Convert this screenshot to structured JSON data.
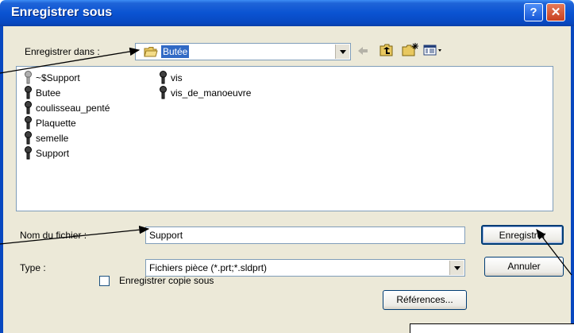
{
  "window": {
    "title": "Enregistrer sous",
    "help_glyph": "?",
    "close_glyph": "✕"
  },
  "save_in": {
    "label": "Enregistrer dans :",
    "folder": "Butée"
  },
  "toolbar": {
    "icons": [
      "back-arrow-icon",
      "up-folder-icon",
      "new-folder-icon",
      "view-menu-icon"
    ]
  },
  "files": {
    "column1": [
      "~$Support",
      "Butee",
      "coulisseau_penté",
      "Plaquette",
      "semelle",
      "Support"
    ],
    "column2": [
      "vis",
      "vis_de_manoeuvre"
    ]
  },
  "filename": {
    "label": "Nom du fichier :",
    "value": "Support"
  },
  "type": {
    "label": "Type :",
    "value": "Fichiers pièce (*.prt;*.sldprt)"
  },
  "buttons": {
    "save": "Enregistrer",
    "cancel": "Annuler",
    "references": "Références..."
  },
  "save_copy": {
    "label": "Enregistrer copie sous",
    "checked": false
  }
}
